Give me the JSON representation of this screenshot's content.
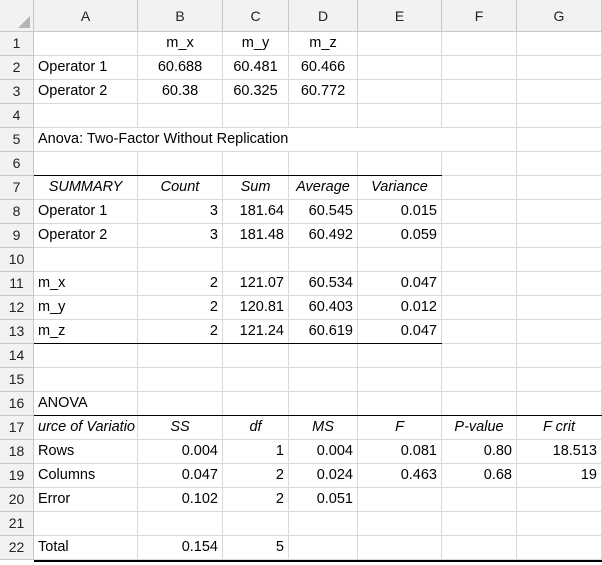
{
  "columns": [
    "A",
    "B",
    "C",
    "D",
    "E",
    "F",
    "G"
  ],
  "rows": [
    "1",
    "2",
    "3",
    "4",
    "5",
    "6",
    "7",
    "8",
    "9",
    "10",
    "11",
    "12",
    "13",
    "14",
    "15",
    "16",
    "17",
    "18",
    "19",
    "20",
    "21",
    "22"
  ],
  "data": {
    "r1": {
      "B": "m_x",
      "C": "m_y",
      "D": "m_z"
    },
    "r2": {
      "A": "Operator 1",
      "B": "60.688",
      "C": "60.481",
      "D": "60.466"
    },
    "r3": {
      "A": "Operator 2",
      "B": "60.38",
      "C": "60.325",
      "D": "60.772"
    },
    "r5": {
      "A": "Anova: Two-Factor Without Replication"
    },
    "r7": {
      "A": "SUMMARY",
      "B": "Count",
      "C": "Sum",
      "D": "Average",
      "E": "Variance"
    },
    "r8": {
      "A": "Operator 1",
      "B": "3",
      "C": "181.64",
      "D": "60.545",
      "E": "0.015"
    },
    "r9": {
      "A": "Operator 2",
      "B": "3",
      "C": "181.48",
      "D": "60.492",
      "E": "0.059"
    },
    "r11": {
      "A": "m_x",
      "B": "2",
      "C": "121.07",
      "D": "60.534",
      "E": "0.047"
    },
    "r12": {
      "A": "m_y",
      "B": "2",
      "C": "120.81",
      "D": "60.403",
      "E": "0.012"
    },
    "r13": {
      "A": "m_z",
      "B": "2",
      "C": "121.24",
      "D": "60.619",
      "E": "0.047"
    },
    "r16": {
      "A": "ANOVA"
    },
    "r17": {
      "A": "urce of Variatio",
      "B": "SS",
      "C": "df",
      "D": "MS",
      "E": "F",
      "F": "P-value",
      "G": "F crit"
    },
    "r18": {
      "A": "Rows",
      "B": "0.004",
      "C": "1",
      "D": "0.004",
      "E": "0.081",
      "F": "0.80",
      "G": "18.513"
    },
    "r19": {
      "A": "Columns",
      "B": "0.047",
      "C": "2",
      "D": "0.024",
      "E": "0.463",
      "F": "0.68",
      "G": "19"
    },
    "r20": {
      "A": "Error",
      "B": "0.102",
      "C": "2",
      "D": "0.051"
    },
    "r22": {
      "A": "Total",
      "B": "0.154",
      "C": "5"
    }
  }
}
